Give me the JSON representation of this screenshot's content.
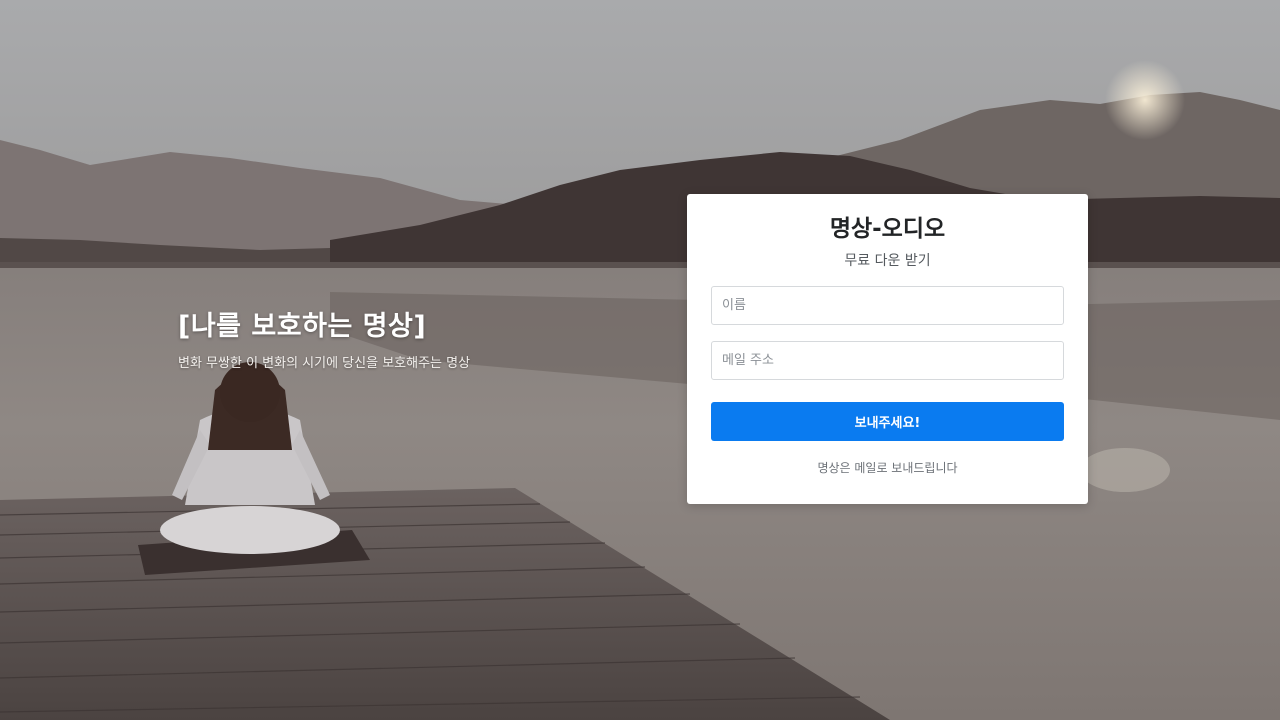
{
  "background": {
    "scene": "lake-meditation-photo"
  },
  "hero": {
    "title": "[나를 보호하는 명상]",
    "subtitle": "변화 무쌍한 이 변화의 시기에 당신을 보호해주는 명상"
  },
  "form": {
    "title": "명상-오디오",
    "subtitle": "무료 다운 받기",
    "name_placeholder": "이름",
    "email_placeholder": "메일 주소",
    "submit_label": "보내주세요!",
    "note": "명상은 메일로 보내드립니다",
    "accent_color": "#0a7bf0"
  }
}
